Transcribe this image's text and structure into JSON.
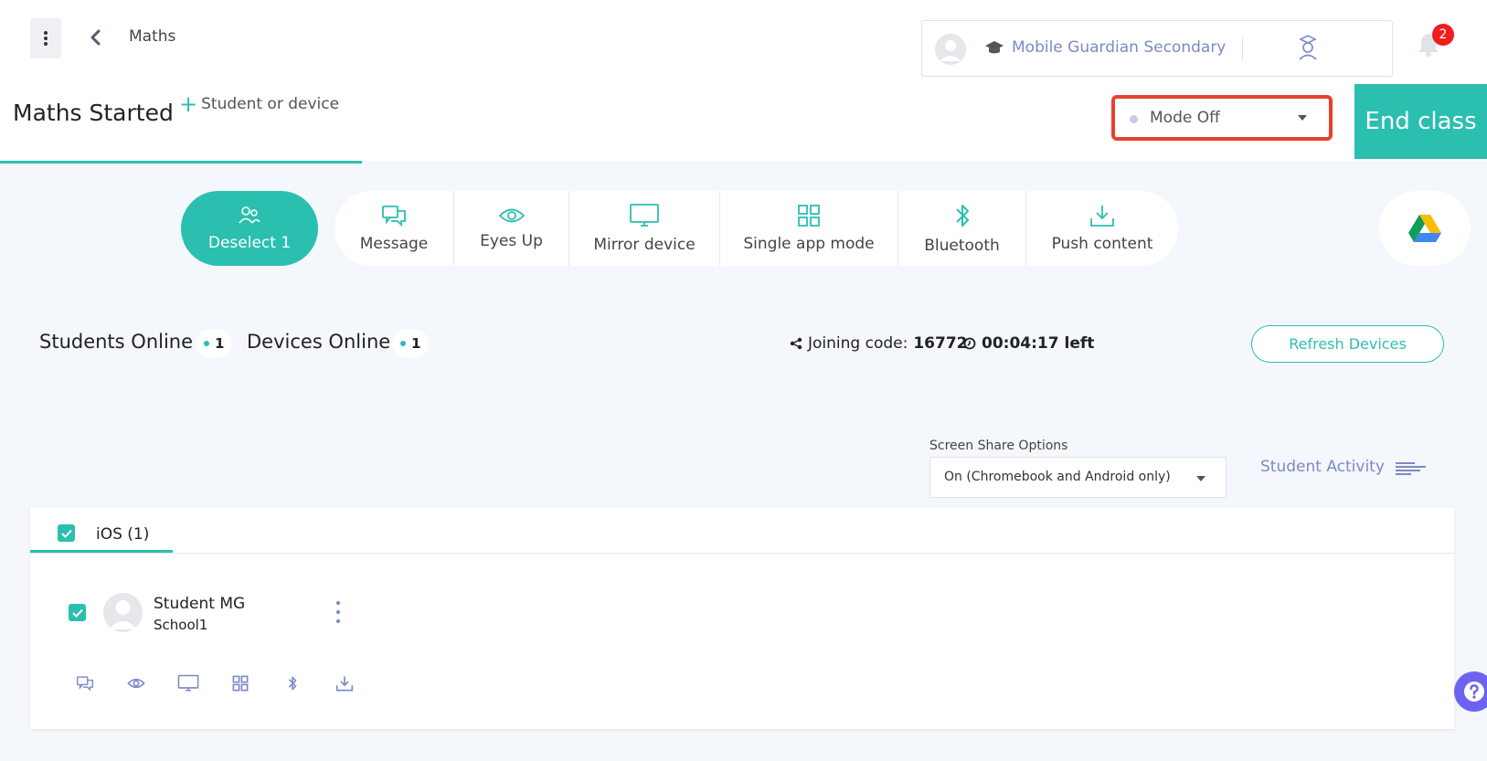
{
  "header": {
    "breadcrumb": "Maths",
    "school_name": "Mobile Guardian Secondary",
    "notification_count": "2"
  },
  "classbar": {
    "title": "Maths Started",
    "add_label": "Student or device",
    "mode_label": "Mode Off",
    "end_class_label": "End class"
  },
  "actions": {
    "deselect_label": "Deselect 1",
    "tools": [
      {
        "label": "Message",
        "icon": "message-icon"
      },
      {
        "label": "Eyes Up",
        "icon": "eye-icon"
      },
      {
        "label": "Mirror device",
        "icon": "monitor-icon"
      },
      {
        "label": "Single app mode",
        "icon": "grid-icon"
      },
      {
        "label": "Bluetooth",
        "icon": "bluetooth-icon"
      },
      {
        "label": "Push content",
        "icon": "download-icon"
      }
    ]
  },
  "status": {
    "students_online_label": "Students Online",
    "students_online_count": "1",
    "devices_online_label": "Devices Online",
    "devices_online_count": "1",
    "joining_code_label": "Joining code:",
    "joining_code": "16772",
    "time_left": "00:04:17 left",
    "refresh_label": "Refresh Devices"
  },
  "screen_share": {
    "label": "Screen Share Options",
    "value": "On (Chromebook and Android only)",
    "activity_label": "Student Activity"
  },
  "devices": {
    "tab_label": "iOS (1)",
    "students": [
      {
        "name": "Student MG",
        "school": "School1"
      }
    ]
  },
  "colors": {
    "accent": "#2bbfb0",
    "link": "#7b8ac4",
    "highlight": "#e8402f",
    "badge": "#f11d1d",
    "help": "#6c63f0"
  }
}
